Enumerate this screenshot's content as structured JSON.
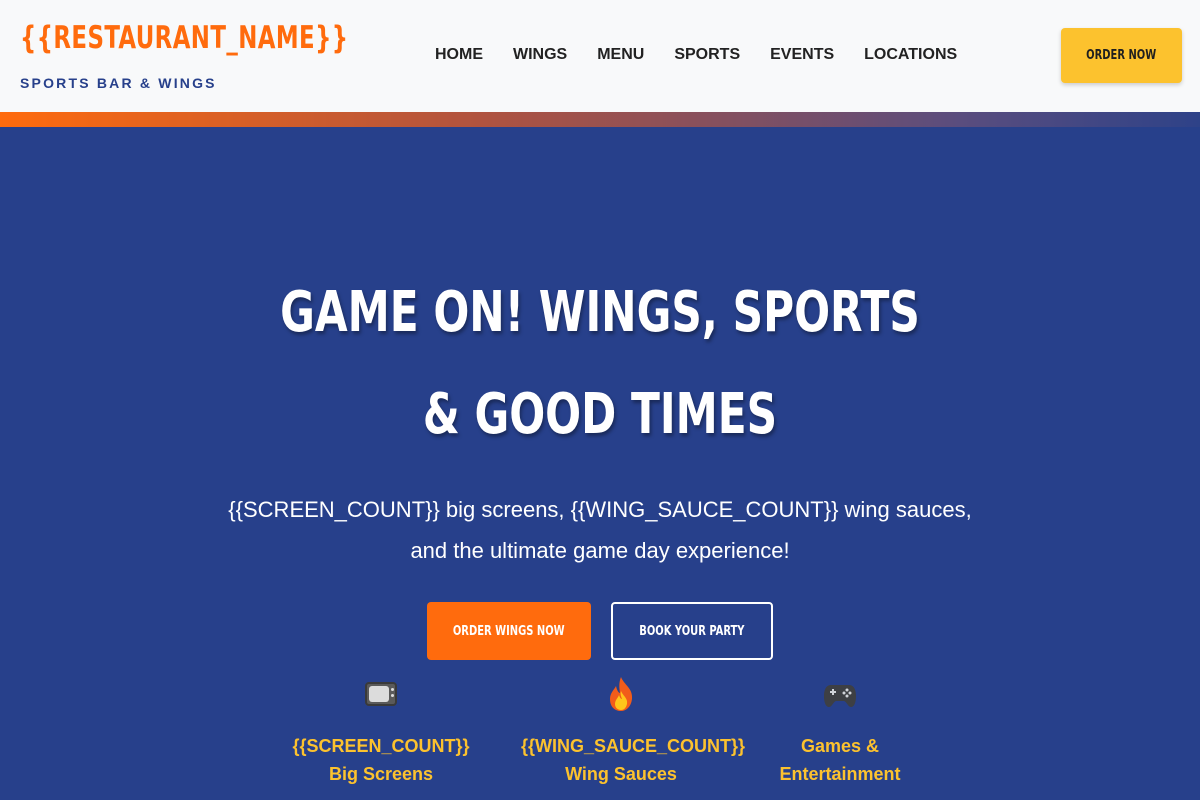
{
  "header": {
    "brand_name": "{{RESTAURANT_NAME}}",
    "tagline": "SPORTS BAR & WINGS",
    "nav": [
      "HOME",
      "WINGS",
      "MENU",
      "SPORTS",
      "EVENTS",
      "LOCATIONS"
    ],
    "order_button": "ORDER NOW"
  },
  "hero": {
    "title": "GAME ON! WINGS, SPORTS & GOOD TIMES",
    "subtitle": "{{SCREEN_COUNT}} big screens, {{WING_SAUCE_COUNT}} wing sauces, and the ultimate game day experience!",
    "primary_button": "ORDER WINGS NOW",
    "secondary_button": "BOOK YOUR PARTY"
  },
  "features": [
    {
      "icon": "tv-icon",
      "title_line1": "{{SCREEN_COUNT}}",
      "title_line2": "Big Screens"
    },
    {
      "icon": "fire-icon",
      "title_line1": "{{WING_SAUCE_COUNT}}",
      "title_line2": "Wing Sauces"
    },
    {
      "icon": "gamepad-icon",
      "title_line1": "Games &",
      "title_line2": "Entertainment"
    }
  ],
  "colors": {
    "brand_orange": "#ff6b0d",
    "navy": "#27408b",
    "gold": "#fcc22e",
    "header_bg": "#f8f9fa"
  }
}
